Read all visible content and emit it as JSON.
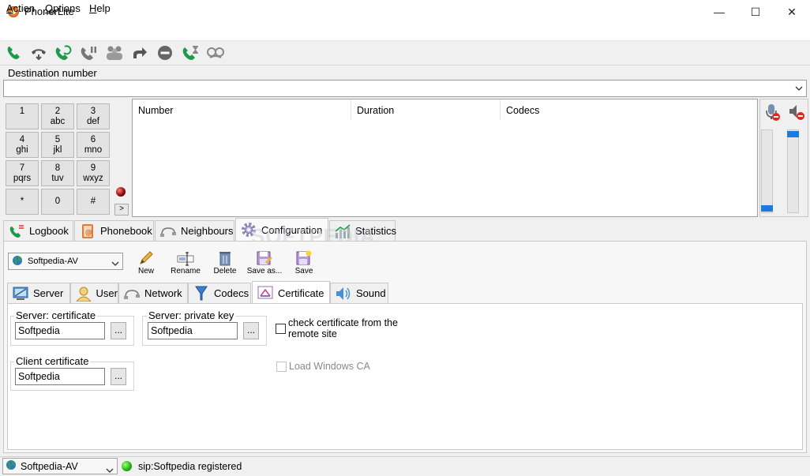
{
  "window": {
    "title": "PhonerLite",
    "minimize": "—",
    "maximize": "☐",
    "close": "✕"
  },
  "menu": [
    {
      "label_first": "A",
      "label_rest": "ction"
    },
    {
      "label_first": "O",
      "label_rest": "ptions"
    },
    {
      "label_first": "H",
      "label_rest": "elp"
    }
  ],
  "destination": {
    "label": "Destination number",
    "value": "",
    "dropdown": "⌵"
  },
  "keypad": [
    {
      "digit": "1",
      "letters": ""
    },
    {
      "digit": "2",
      "letters": "abc"
    },
    {
      "digit": "3",
      "letters": "def"
    },
    {
      "digit": "4",
      "letters": "ghi"
    },
    {
      "digit": "5",
      "letters": "jkl"
    },
    {
      "digit": "6",
      "letters": "mno"
    },
    {
      "digit": "7",
      "letters": "pqrs"
    },
    {
      "digit": "8",
      "letters": "tuv"
    },
    {
      "digit": "9",
      "letters": "wxyz"
    },
    {
      "digit": "*",
      "letters": ""
    },
    {
      "digit": "0",
      "letters": ""
    },
    {
      "digit": "#",
      "letters": ""
    }
  ],
  "more_button": ">",
  "call_list": {
    "columns": [
      "Number",
      "Duration",
      "Codecs"
    ]
  },
  "main_tabs": [
    {
      "label": "Logbook"
    },
    {
      "label": "Phonebook"
    },
    {
      "label": "Neighbours"
    },
    {
      "label": "Configuration"
    },
    {
      "label": "Statistics"
    }
  ],
  "config": {
    "profile": "Softpedia-AV",
    "buttons": {
      "new": "New",
      "rename": "Rename",
      "delete": "Delete",
      "save_as": "Save as...",
      "save": "Save"
    }
  },
  "config_tabs": [
    {
      "label": "Server"
    },
    {
      "label": "User"
    },
    {
      "label": "Network"
    },
    {
      "label": "Codecs"
    },
    {
      "label": "Certificate"
    },
    {
      "label": "Sound"
    }
  ],
  "certificate": {
    "server_cert": {
      "label": "Server: certificate",
      "value": "Softpedia",
      "browse": "..."
    },
    "server_key": {
      "label": "Server: private key",
      "value": "Softpedia",
      "browse": "..."
    },
    "client_cert": {
      "label": "Client certificate",
      "value": "Softpedia",
      "browse": "..."
    },
    "check_remote_line1": "check certificate from the",
    "check_remote_line2": "remote site",
    "load_windows_ca": "Load Windows CA"
  },
  "status": {
    "profile": "Softpedia-AV",
    "text": "sip:Softpedia registered"
  },
  "watermark": "SOFTPEDIA"
}
